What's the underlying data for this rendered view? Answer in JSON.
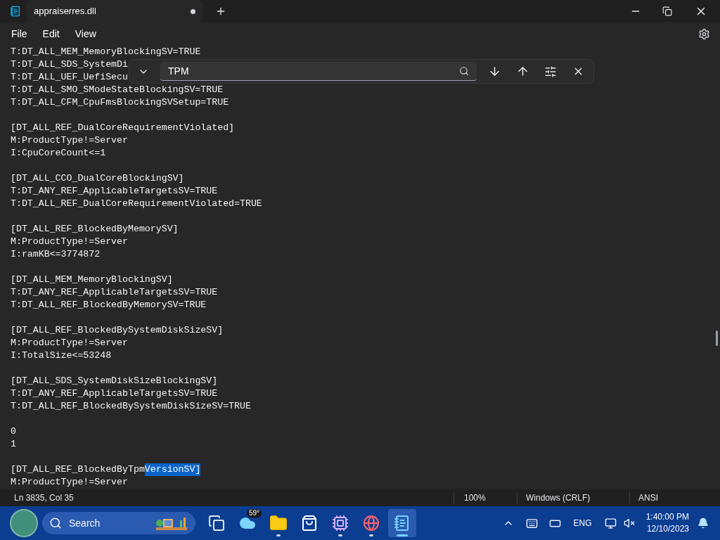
{
  "window": {
    "tab_title": "appraiserres.dll",
    "unsaved": true
  },
  "menu": [
    "File",
    "Edit",
    "View"
  ],
  "find": {
    "value": "TPM"
  },
  "editor": {
    "blocks": [
      [
        {
          "text": "T:DT_ALL_MEM_MemoryBlockingSV=TRUE"
        },
        {
          "text": "T:DT_ALL_SDS_SystemDi"
        },
        {
          "text": "T:DT_ALL_UEF_UefiSecu"
        },
        {
          "text": "T:DT_ALL_SMO_SModeStateBlockingSV=TRUE"
        },
        {
          "text": "T:DT_ALL_CFM_CpuFmsBlockingSVSetup=TRUE"
        }
      ],
      [
        {
          "text": "[DT_ALL_REF_DualCoreRequirementViolated]"
        },
        {
          "text": "M:ProductType!=Server"
        },
        {
          "text": "I:CpuCoreCount<=1"
        }
      ],
      [
        {
          "text": "[DT_ALL_CCO_DualCoreBlockingSV]"
        },
        {
          "text": "T:DT_ANY_REF_ApplicableTargetsSV=TRUE"
        },
        {
          "text": "T:DT_ALL_REF_DualCoreRequirementViolated=TRUE"
        }
      ],
      [
        {
          "text": "[DT_ALL_REF_BlockedByMemorySV]"
        },
        {
          "text": "M:ProductType!=Server"
        },
        {
          "text": "I:ramKB<=3774872"
        }
      ],
      [
        {
          "text": "[DT_ALL_MEM_MemoryBlockingSV]"
        },
        {
          "text": "T:DT_ANY_REF_ApplicableTargetsSV=TRUE"
        },
        {
          "text": "T:DT_ALL_REF_BlockedByMemorySV=TRUE"
        }
      ],
      [
        {
          "text": "[DT_ALL_REF_BlockedBySystemDiskSizeSV]"
        },
        {
          "text": "M:ProductType!=Server"
        },
        {
          "text": "I:TotalSize<=53248"
        }
      ],
      [
        {
          "text": "[DT_ALL_SDS_SystemDiskSizeBlockingSV]"
        },
        {
          "text": "T:DT_ANY_REF_ApplicableTargetsSV=TRUE"
        },
        {
          "text": "T:DT_ALL_REF_BlockedBySystemDiskSizeSV=TRUE"
        }
      ],
      [
        {
          "text": "0"
        },
        {
          "text": "1"
        }
      ],
      [
        {
          "text": "[DT_ALL_REF_BlockedByTpm",
          "selected_text": "VersionSV]"
        },
        {
          "text": "M:ProductType!=Server"
        }
      ]
    ]
  },
  "status_bar": {
    "position": "Ln 3835, Col 35",
    "zoom": "100%",
    "line_ending": "Windows (CRLF)",
    "encoding": "ANSI"
  },
  "taskbar": {
    "search_placeholder": "Search",
    "apps": [
      {
        "kind": "taskview",
        "running": false,
        "selected": false
      },
      {
        "kind": "weather",
        "badge": "59°",
        "running": false,
        "selected": false
      },
      {
        "kind": "explorer",
        "running": true,
        "selected": false
      },
      {
        "kind": "store",
        "running": false,
        "selected": false
      },
      {
        "kind": "chip",
        "running": true,
        "selected": false
      },
      {
        "kind": "browser",
        "running": true,
        "selected": false
      },
      {
        "kind": "notepad",
        "running": true,
        "selected": true
      }
    ],
    "tray": {
      "language": "ENG",
      "time": "1:40:00 PM",
      "date": "12/10/2023"
    }
  }
}
